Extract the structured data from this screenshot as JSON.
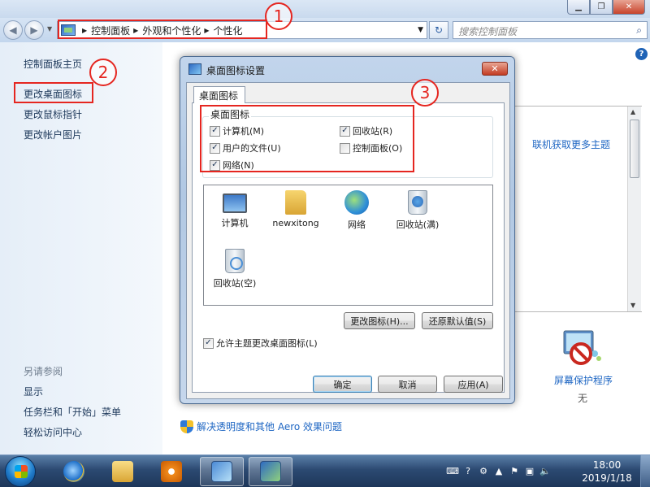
{
  "window": {
    "minimize_glyph": "▁",
    "maximize_glyph": "❐",
    "close_glyph": "✕"
  },
  "navbar": {
    "breadcrumbs": [
      "控制面板",
      "外观和个性化",
      "个性化"
    ],
    "search_placeholder": "搜索控制面板",
    "refresh_glyph": "↻",
    "search_glyph": "⌕",
    "back_glyph": "◀",
    "forward_glyph": "▶"
  },
  "left_pane": {
    "home": "控制面板主页",
    "links": [
      "更改桌面图标",
      "更改鼠标指针",
      "更改帐户图片"
    ],
    "see_also_heading": "另请参阅",
    "see_also": [
      "显示",
      "任务栏和「开始」菜单",
      "轻松访问中心"
    ]
  },
  "main": {
    "help_glyph": "?",
    "get_more_themes": "联机获取更多主题",
    "screensaver_label": "屏幕保护程序",
    "screensaver_value": "无",
    "aero_link": "解决透明度和其他 Aero 效果问题"
  },
  "dialog": {
    "title": "桌面图标设置",
    "close_glyph": "✕",
    "tab": "桌面图标",
    "group_title": "桌面图标",
    "checkboxes": [
      {
        "label": "计算机(M)",
        "checked": true
      },
      {
        "label": "回收站(R)",
        "checked": true
      },
      {
        "label": "用户的文件(U)",
        "checked": true
      },
      {
        "label": "控制面板(O)",
        "checked": false
      },
      {
        "label": "网络(N)",
        "checked": true
      }
    ],
    "icons": [
      "计算机",
      "newxitong",
      "网络",
      "回收站(满)",
      "回收站(空)"
    ],
    "change_icon_button": "更改图标(H)...",
    "restore_default_button": "还原默认值(S)",
    "allow_themes_checkbox": "允许主题更改桌面图标(L)",
    "allow_themes_checked": true,
    "ok": "确定",
    "cancel": "取消",
    "apply": "应用(A)"
  },
  "annotations": [
    "1",
    "2",
    "3"
  ],
  "taskbar": {
    "time": "18:00",
    "date": "2019/1/18"
  },
  "colors": {
    "annotation_red": "#e52620",
    "link_blue": "#1e66c3"
  }
}
